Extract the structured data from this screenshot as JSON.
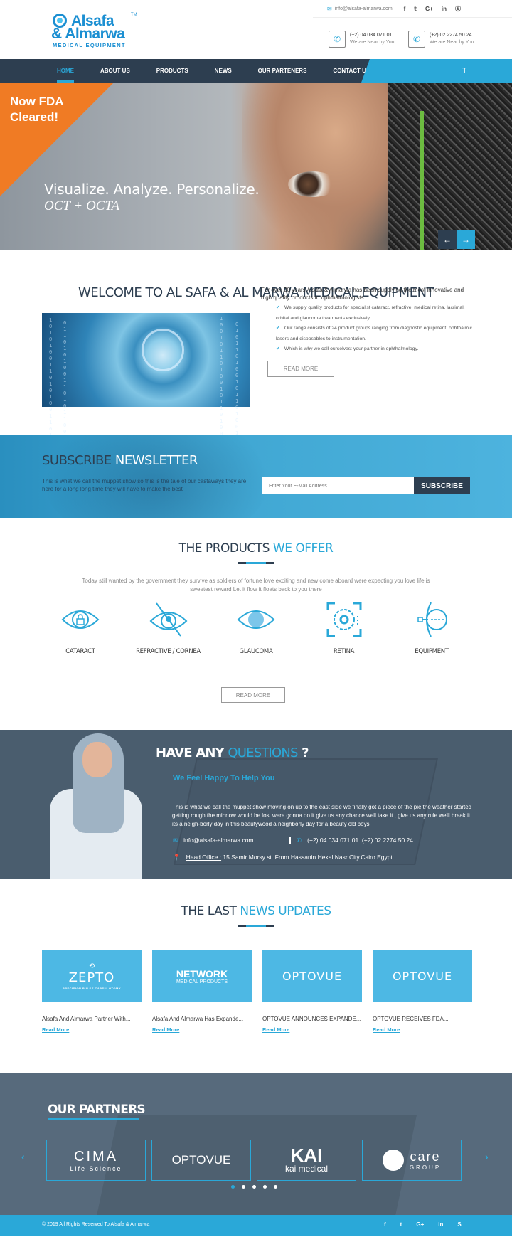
{
  "header": {
    "logo": {
      "line1": "Alsafa",
      "line2": "& Almarwa",
      "line3": "MEDICAL EQUIPMENT",
      "tm": "TM"
    },
    "topbar": {
      "email": "info@alsafa-almarwa.com",
      "separator": "|",
      "social": [
        {
          "name": "facebook-icon",
          "glyph": "f"
        },
        {
          "name": "twitter-icon",
          "glyph": "🐦"
        },
        {
          "name": "google-plus-icon",
          "glyph": "G+"
        },
        {
          "name": "linkedin-icon",
          "glyph": "in"
        },
        {
          "name": "skype-icon",
          "glyph": "S"
        }
      ]
    },
    "phones": [
      {
        "number": "(+2) 04 034 071 01",
        "sub": "We are Near by You"
      },
      {
        "number": "(+2) 02 2274 50 24",
        "sub": "We are Near by You"
      }
    ]
  },
  "nav": {
    "items": [
      "HOME",
      "ABOUT US",
      "PRODUCTS",
      "NEWS",
      "OUR PARTENERS",
      "CONTACT US"
    ],
    "active": "HOME",
    "search_icon": "T"
  },
  "hero": {
    "badge": "Now FDA Cleared!",
    "tagline": "Visualize. Analyze. Personalize.",
    "subtagline": "OCT + OCTA",
    "prev": "←",
    "next": "→"
  },
  "welcome": {
    "title": "WELCOME TO AL SAFA & AL MARWA MEDICAL EQUIPMENT",
    "intro": "For over 20 years Alsafa & Almarwa has been supplying the most innovative and high quality products to ophthalmologists.",
    "bullets": [
      "We supply quality products for specialist cataract, refractive, medical retina, lacrimal, orbital and glaucoma treatments exclusively.",
      "Our range consists of 24 product groups ranging from diagnostic equipment, ophthalmic lasers and disposables to instrumentation.",
      "Which is why we call ourselves: your partner in ophthalmology."
    ],
    "check": "✔",
    "read_more": "READ MORE"
  },
  "newsletter": {
    "title_a": "SUBSCRIBE",
    "title_b": "NEWSLETTER",
    "text": "This is what we call the muppet show so this is the tale of our castaways they are here for a long long time they will have to make the best",
    "placeholder": "Enter Your E-Mail Address",
    "button": "SUBSCRIBE"
  },
  "products": {
    "title_a": "THE PRODUCTS",
    "title_b": "WE OFFER",
    "desc": "Today still wanted by the government they survive as soldiers of fortune love exciting and new come aboard were expecting you love life is sweetest reward Let it flow it floats back to you there",
    "items": [
      {
        "label": "CATARACT",
        "icon": "eye-lock-icon"
      },
      {
        "label": "REFRACTIVE / CORNEA",
        "icon": "eye-slash-icon"
      },
      {
        "label": "GLAUCOMA",
        "icon": "eye-icon"
      },
      {
        "label": "RETINA",
        "icon": "retina-scan-icon"
      },
      {
        "label": "EQUIPMENT",
        "icon": "eye-laser-icon"
      }
    ],
    "read_more": "READ MORE"
  },
  "questions": {
    "title_a": "HAVE ANY",
    "title_b": "QUESTIONS",
    "title_c": "?",
    "subtitle": "We Feel Happy To Help You",
    "text": "This is what we call the muppet show moving on up to the east side we finally got a piece of the pie the weather started getting rough the minnow would be lost were gonna do it give us any chance well take it , give us any rule we'll break it its a neigh-borly day in this beautywood a neighborly day for a beauty old boys.",
    "email": "info@alsafa-almarwa.com",
    "phones": "(+2) 04 034 071 01 ,(+2) 02 2274 50 24",
    "office_label": "Head Office :",
    "office": "15 Samir Morsy st. From Hassanin Hekal Nasr City.Cairo.Egypt"
  },
  "updates": {
    "title_a": "THE LAST",
    "title_b": "NEWS UPDATES",
    "cards": [
      {
        "logo": "ZEPTO",
        "logo_sub": "PRECISION PULSE CAPSULOTOMY",
        "title": "Alsafa And Almarwa Partner With...",
        "link": "Read More"
      },
      {
        "logo": "NETWORK",
        "logo_sub": "MEDICAL PRODUCTS",
        "title": "Alsafa And Almarwa Has Expande...",
        "link": "Read More"
      },
      {
        "logo": "OPTOVUE",
        "logo_sub": "",
        "title": "OPTOVUE ANNOUNCES EXPANDE...",
        "link": "Read More"
      },
      {
        "logo": "OPTOVUE",
        "logo_sub": "",
        "title": "OPTOVUE RECEIVES FDA...",
        "link": "Read More"
      }
    ]
  },
  "partners": {
    "title": "OUR PARTNERS",
    "items": [
      {
        "name": "CIMA",
        "sub": "Life Science"
      },
      {
        "name": "OPTOVUE",
        "sub": ""
      },
      {
        "name": "KAI",
        "sub": "kai medical"
      },
      {
        "name": "care",
        "sub": "GROUP"
      }
    ],
    "prev": "‹",
    "next": "›",
    "dots": 5,
    "active_dot": 1
  },
  "footer": {
    "copyright": "© 2019 All Rights Reserved To Alsafa & Almarwa",
    "social": [
      "f",
      "t",
      "G+",
      "in",
      "S"
    ]
  },
  "colors": {
    "accent": "#2aa8d8",
    "dark": "#2d3e50",
    "orange": "#f07b24"
  }
}
